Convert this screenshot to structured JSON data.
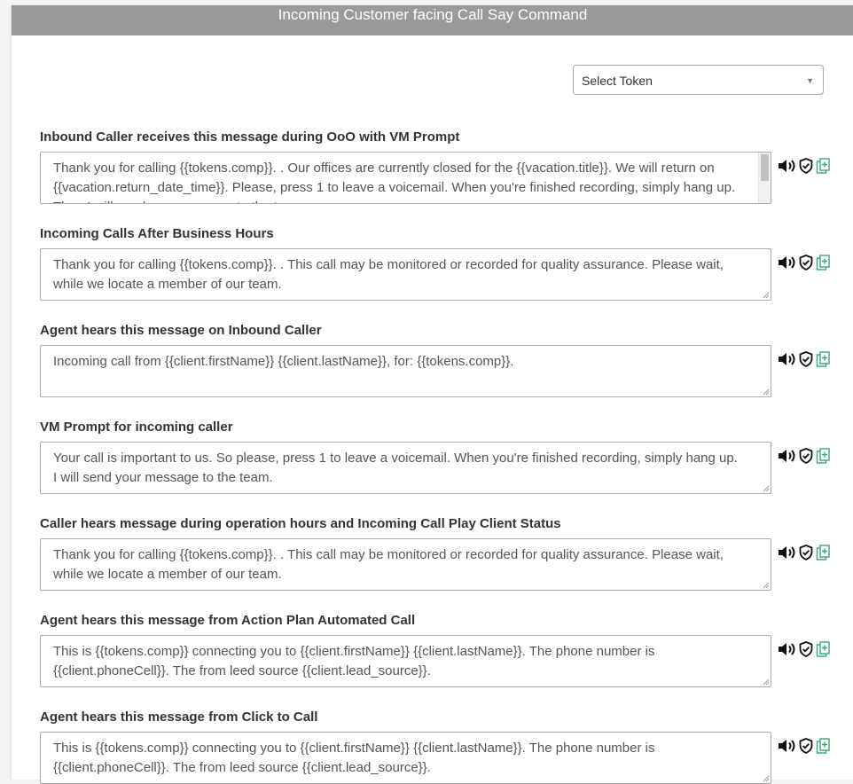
{
  "header": {
    "title": "Incoming Customer facing Call Say Command"
  },
  "token_select": {
    "placeholder": "Select Token"
  },
  "sections": [
    {
      "label": "Inbound Caller receives this message during OoO with VM Prompt",
      "text": "Thank you for calling {{tokens.comp}}. . Our offices are currently closed for the {{vacation.title}}. We will return on {{vacation.return_date_time}}. Please, press 1 to leave a voicemail. When you're finished recording, simply hang up. Then I will send your message to the team."
    },
    {
      "label": "Incoming Calls After Business Hours",
      "text": "Thank you for calling {{tokens.comp}}. . This call may be monitored or recorded for quality assurance. Please wait, while we locate a member of our team."
    },
    {
      "label": "Agent hears this message on Inbound Caller",
      "text": "Incoming call from {{client.firstName}} {{client.lastName}}, for: {{tokens.comp}}."
    },
    {
      "label": "VM Prompt for incoming caller",
      "text": "Your call is important to us. So please, press 1 to leave a voicemail. When you're finished recording, simply hang up. I will send your message to the team."
    },
    {
      "label": "Caller hears message during operation hours and Incoming Call Play Client Status",
      "text": "Thank you for calling {{tokens.comp}}. . This call may be monitored or recorded for quality assurance. Please wait, while we locate a member of our team."
    },
    {
      "label": "Agent hears this message from Action Plan Automated Call",
      "text": "This is {{tokens.comp}} connecting you to {{client.firstName}} {{client.lastName}}. The phone number is {{client.phoneCell}}. The  from leed source {{client.lead_source}}."
    },
    {
      "label": "Agent hears this message from Click to Call",
      "text": "This is {{tokens.comp}} connecting you to {{client.firstName}} {{client.lastName}}. The phone number is {{client.phoneCell}}. The  from leed source {{client.lead_source}}."
    }
  ],
  "icons": {
    "play": "speaker-icon",
    "verify": "shield-check-icon",
    "insert": "add-token-icon"
  },
  "colors": {
    "header_bg": "#9a9a9a",
    "insert_icon": "#3aa873"
  }
}
